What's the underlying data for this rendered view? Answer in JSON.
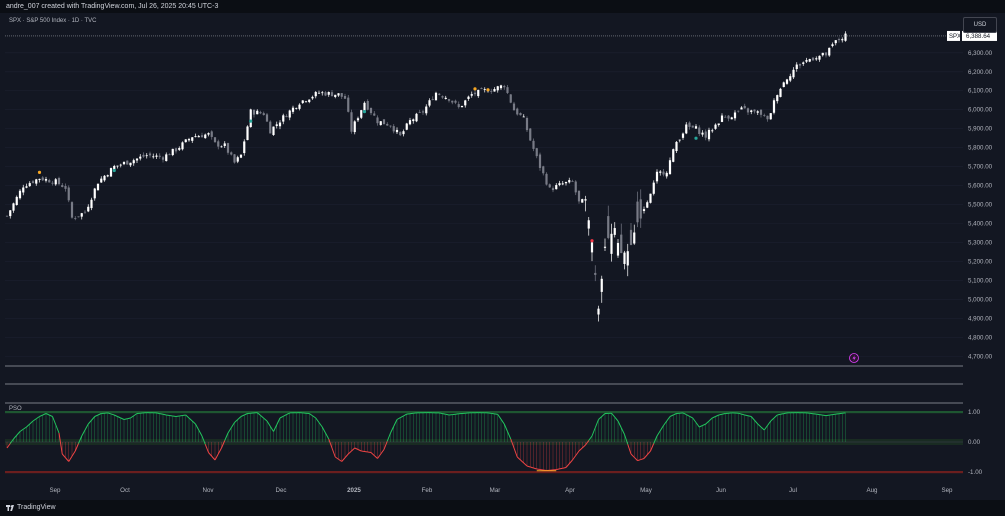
{
  "header": {
    "text": "andre_007 created with TradingView.com, Jul 26, 2025 20:45 UTC-3"
  },
  "legend": {
    "text": "SPX · S&P 500 Index · 1D · TVC"
  },
  "currency_button": "USD",
  "last_price": {
    "symbol": "SPX",
    "value": "6,388.64"
  },
  "pso_label": "PSO",
  "footer": {
    "brand": "TradingView"
  },
  "colors": {
    "background": "#131722",
    "up_candle": "#ffffff",
    "down_candle": "#787b86",
    "pso_bull": "#22c55e",
    "pso_bear": "#ef4444",
    "dot_orange": "#f5a623",
    "dot_teal": "#26a69a",
    "dot_red": "#f23645"
  },
  "chart_data": [
    {
      "type": "candlestick",
      "title": "SPX · S&P 500 Index · 1D · TVC",
      "y_ticks": [
        "6,300.00",
        "6,200.00",
        "6,100.00",
        "6,000.00",
        "5,900.00",
        "5,800.00",
        "5,700.00",
        "5,600.00",
        "5,500.00",
        "5,400.00",
        "5,300.00",
        "5,200.00",
        "5,100.00",
        "5,000.00",
        "4,900.00",
        "4,800.00",
        "4,700.00"
      ],
      "ylim": [
        4650,
        6420
      ],
      "x_ticks": [
        "Sep",
        "Oct",
        "Nov",
        "Dec",
        "2025",
        "Feb",
        "Mar",
        "Apr",
        "May",
        "Jun",
        "Jul",
        "Aug",
        "Sep"
      ],
      "last_value": 6388.64,
      "anchors": [
        [
          0,
          5440
        ],
        [
          5,
          5600
        ],
        [
          10,
          5640
        ],
        [
          15,
          5620
        ],
        [
          18,
          5590
        ],
        [
          20,
          5430
        ],
        [
          24,
          5460
        ],
        [
          28,
          5620
        ],
        [
          33,
          5700
        ],
        [
          38,
          5730
        ],
        [
          43,
          5760
        ],
        [
          48,
          5750
        ],
        [
          52,
          5790
        ],
        [
          57,
          5860
        ],
        [
          62,
          5870
        ],
        [
          64,
          5820
        ],
        [
          67,
          5810
        ],
        [
          70,
          5720
        ],
        [
          72,
          5760
        ],
        [
          75,
          5990
        ],
        [
          79,
          5980
        ],
        [
          81,
          5890
        ],
        [
          85,
          5960
        ],
        [
          90,
          6040
        ],
        [
          96,
          6090
        ],
        [
          102,
          6080
        ],
        [
          104,
          6060
        ],
        [
          106,
          5890
        ],
        [
          110,
          6040
        ],
        [
          114,
          5940
        ],
        [
          118,
          5920
        ],
        [
          121,
          5860
        ],
        [
          124,
          5940
        ],
        [
          128,
          5990
        ],
        [
          132,
          6090
        ],
        [
          136,
          6060
        ],
        [
          139,
          6010
        ],
        [
          143,
          6080
        ],
        [
          147,
          6100
        ],
        [
          150,
          6110
        ],
        [
          153,
          6130
        ],
        [
          156,
          6000
        ],
        [
          159,
          5950
        ],
        [
          161,
          5840
        ],
        [
          164,
          5700
        ],
        [
          167,
          5580
        ],
        [
          171,
          5610
        ],
        [
          174,
          5620
        ],
        [
          176,
          5510
        ],
        [
          178,
          5520
        ],
        [
          180,
          5300
        ],
        [
          182,
          4960
        ],
        [
          184,
          5280
        ],
        [
          187,
          5370
        ],
        [
          189,
          5250
        ],
        [
          191,
          5250
        ],
        [
          194,
          5400
        ],
        [
          196,
          5480
        ],
        [
          198,
          5550
        ],
        [
          200,
          5660
        ],
        [
          203,
          5680
        ],
        [
          206,
          5830
        ],
        [
          209,
          5910
        ],
        [
          212,
          5900
        ],
        [
          215,
          5860
        ],
        [
          217,
          5900
        ],
        [
          220,
          5960
        ],
        [
          223,
          5970
        ],
        [
          226,
          6000
        ],
        [
          229,
          5990
        ],
        [
          232,
          5980
        ],
        [
          234,
          5940
        ],
        [
          237,
          6090
        ],
        [
          240,
          6170
        ],
        [
          243,
          6230
        ],
        [
          246,
          6260
        ],
        [
          249,
          6280
        ],
        [
          252,
          6290
        ],
        [
          255,
          6360
        ],
        [
          258,
          6388.64
        ]
      ],
      "signals": [
        {
          "marker": "orange",
          "x_index": 10,
          "y": 5670
        },
        {
          "marker": "teal",
          "x_index": 33,
          "y": 5680
        },
        {
          "marker": "teal",
          "x_index": 75,
          "y": 5940
        },
        {
          "marker": "teal",
          "x_index": 110,
          "y": 5990
        },
        {
          "marker": "orange",
          "x_index": 144,
          "y": 6110
        },
        {
          "marker": "orange",
          "x_index": 148,
          "y": 6105
        },
        {
          "marker": "red",
          "x_index": 180,
          "y": 5310
        },
        {
          "marker": "teal",
          "x_index": 212,
          "y": 5850
        }
      ]
    },
    {
      "type": "area",
      "title": "PSO",
      "y_ticks": [
        "1.00",
        "0.00",
        "-1.00"
      ],
      "ylim": [
        -1.1,
        1.1
      ],
      "segments": [
        [
          0,
          -0.2
        ],
        [
          2,
          0.1
        ],
        [
          4,
          0.35
        ],
        [
          6,
          0.5
        ],
        [
          8,
          0.7
        ],
        [
          10,
          0.85
        ],
        [
          12,
          0.95
        ],
        [
          14,
          0.85
        ],
        [
          16,
          0.3
        ],
        [
          17,
          -0.4
        ],
        [
          19,
          -0.65
        ],
        [
          21,
          -0.3
        ],
        [
          23,
          0.2
        ],
        [
          25,
          0.6
        ],
        [
          27,
          0.85
        ],
        [
          29,
          0.95
        ],
        [
          31,
          0.97
        ],
        [
          33,
          0.9
        ],
        [
          36,
          0.75
        ],
        [
          38,
          0.8
        ],
        [
          40,
          0.95
        ],
        [
          43,
          0.98
        ],
        [
          46,
          0.97
        ],
        [
          49,
          0.9
        ],
        [
          52,
          0.85
        ],
        [
          55,
          0.9
        ],
        [
          58,
          0.6
        ],
        [
          60,
          0.2
        ],
        [
          62,
          -0.35
        ],
        [
          64,
          -0.6
        ],
        [
          66,
          -0.2
        ],
        [
          68,
          0.3
        ],
        [
          70,
          0.65
        ],
        [
          72,
          0.85
        ],
        [
          74,
          0.95
        ],
        [
          77,
          0.98
        ],
        [
          80,
          0.7
        ],
        [
          82,
          0.35
        ],
        [
          84,
          0.8
        ],
        [
          87,
          0.97
        ],
        [
          90,
          0.98
        ],
        [
          93,
          0.95
        ],
        [
          95,
          0.8
        ],
        [
          97,
          0.5
        ],
        [
          99,
          0.1
        ],
        [
          101,
          -0.5
        ],
        [
          103,
          -0.65
        ],
        [
          105,
          -0.4
        ],
        [
          107,
          -0.2
        ],
        [
          109,
          -0.3
        ],
        [
          112,
          -0.35
        ],
        [
          114,
          -0.55
        ],
        [
          116,
          -0.25
        ],
        [
          118,
          0.3
        ],
        [
          120,
          0.75
        ],
        [
          123,
          0.93
        ],
        [
          126,
          0.97
        ],
        [
          129,
          0.98
        ],
        [
          133,
          0.97
        ],
        [
          136,
          0.9
        ],
        [
          139,
          0.94
        ],
        [
          142,
          0.97
        ],
        [
          145,
          0.98
        ],
        [
          148,
          0.97
        ],
        [
          151,
          0.92
        ],
        [
          153,
          0.6
        ],
        [
          155,
          0.1
        ],
        [
          157,
          -0.5
        ],
        [
          160,
          -0.8
        ],
        [
          163,
          -0.9
        ],
        [
          166,
          -0.95
        ],
        [
          169,
          -0.92
        ],
        [
          172,
          -0.85
        ],
        [
          174,
          -0.6
        ],
        [
          176,
          -0.3
        ],
        [
          178,
          -0.1
        ],
        [
          180,
          0.2
        ],
        [
          182,
          0.75
        ],
        [
          184,
          0.95
        ],
        [
          186,
          0.96
        ],
        [
          188,
          0.7
        ],
        [
          190,
          0.25
        ],
        [
          192,
          -0.4
        ],
        [
          194,
          -0.62
        ],
        [
          196,
          -0.55
        ],
        [
          198,
          -0.3
        ],
        [
          200,
          0.2
        ],
        [
          202,
          0.55
        ],
        [
          204,
          0.85
        ],
        [
          206,
          0.95
        ],
        [
          208,
          0.97
        ],
        [
          211,
          0.8
        ],
        [
          213,
          0.5
        ],
        [
          215,
          0.6
        ],
        [
          217,
          0.8
        ],
        [
          219,
          0.9
        ],
        [
          221,
          0.95
        ],
        [
          223,
          0.97
        ],
        [
          225,
          0.96
        ],
        [
          227,
          0.9
        ],
        [
          229,
          0.85
        ],
        [
          231,
          0.6
        ],
        [
          233,
          0.4
        ],
        [
          235,
          0.7
        ],
        [
          237,
          0.9
        ],
        [
          240,
          0.97
        ],
        [
          243,
          0.98
        ],
        [
          246,
          0.97
        ],
        [
          249,
          0.93
        ],
        [
          252,
          0.88
        ],
        [
          255,
          0.93
        ],
        [
          258,
          0.97
        ]
      ]
    }
  ]
}
